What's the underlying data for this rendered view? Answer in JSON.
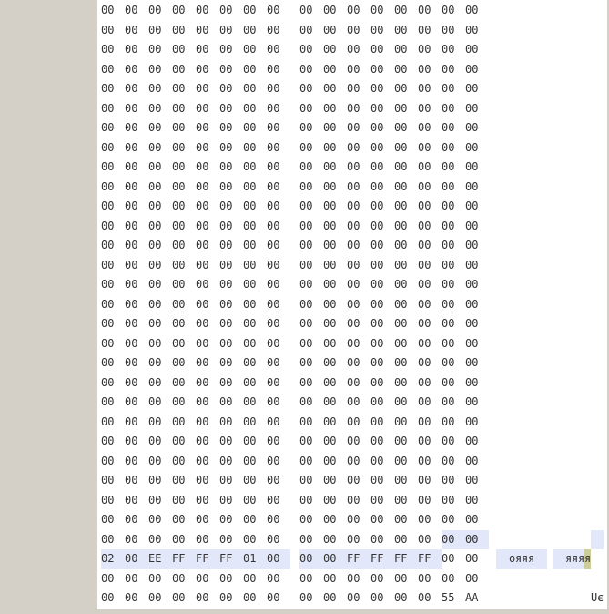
{
  "hex_rows": [
    {
      "bytes": [
        "00",
        "00",
        "00",
        "00",
        "00",
        "00",
        "00",
        "00",
        "00",
        "00",
        "00",
        "00",
        "00",
        "00",
        "00",
        "00"
      ],
      "highlights": []
    },
    {
      "bytes": [
        "00",
        "00",
        "00",
        "00",
        "00",
        "00",
        "00",
        "00",
        "00",
        "00",
        "00",
        "00",
        "00",
        "00",
        "00",
        "00"
      ],
      "highlights": []
    },
    {
      "bytes": [
        "00",
        "00",
        "00",
        "00",
        "00",
        "00",
        "00",
        "00",
        "00",
        "00",
        "00",
        "00",
        "00",
        "00",
        "00",
        "00"
      ],
      "highlights": []
    },
    {
      "bytes": [
        "00",
        "00",
        "00",
        "00",
        "00",
        "00",
        "00",
        "00",
        "00",
        "00",
        "00",
        "00",
        "00",
        "00",
        "00",
        "00"
      ],
      "highlights": []
    },
    {
      "bytes": [
        "00",
        "00",
        "00",
        "00",
        "00",
        "00",
        "00",
        "00",
        "00",
        "00",
        "00",
        "00",
        "00",
        "00",
        "00",
        "00"
      ],
      "highlights": []
    },
    {
      "bytes": [
        "00",
        "00",
        "00",
        "00",
        "00",
        "00",
        "00",
        "00",
        "00",
        "00",
        "00",
        "00",
        "00",
        "00",
        "00",
        "00"
      ],
      "highlights": []
    },
    {
      "bytes": [
        "00",
        "00",
        "00",
        "00",
        "00",
        "00",
        "00",
        "00",
        "00",
        "00",
        "00",
        "00",
        "00",
        "00",
        "00",
        "00"
      ],
      "highlights": []
    },
    {
      "bytes": [
        "00",
        "00",
        "00",
        "00",
        "00",
        "00",
        "00",
        "00",
        "00",
        "00",
        "00",
        "00",
        "00",
        "00",
        "00",
        "00"
      ],
      "highlights": []
    },
    {
      "bytes": [
        "00",
        "00",
        "00",
        "00",
        "00",
        "00",
        "00",
        "00",
        "00",
        "00",
        "00",
        "00",
        "00",
        "00",
        "00",
        "00"
      ],
      "highlights": []
    },
    {
      "bytes": [
        "00",
        "00",
        "00",
        "00",
        "00",
        "00",
        "00",
        "00",
        "00",
        "00",
        "00",
        "00",
        "00",
        "00",
        "00",
        "00"
      ],
      "highlights": []
    },
    {
      "bytes": [
        "00",
        "00",
        "00",
        "00",
        "00",
        "00",
        "00",
        "00",
        "00",
        "00",
        "00",
        "00",
        "00",
        "00",
        "00",
        "00"
      ],
      "highlights": []
    },
    {
      "bytes": [
        "00",
        "00",
        "00",
        "00",
        "00",
        "00",
        "00",
        "00",
        "00",
        "00",
        "00",
        "00",
        "00",
        "00",
        "00",
        "00"
      ],
      "highlights": []
    },
    {
      "bytes": [
        "00",
        "00",
        "00",
        "00",
        "00",
        "00",
        "00",
        "00",
        "00",
        "00",
        "00",
        "00",
        "00",
        "00",
        "00",
        "00"
      ],
      "highlights": []
    },
    {
      "bytes": [
        "00",
        "00",
        "00",
        "00",
        "00",
        "00",
        "00",
        "00",
        "00",
        "00",
        "00",
        "00",
        "00",
        "00",
        "00",
        "00"
      ],
      "highlights": []
    },
    {
      "bytes": [
        "00",
        "00",
        "00",
        "00",
        "00",
        "00",
        "00",
        "00",
        "00",
        "00",
        "00",
        "00",
        "00",
        "00",
        "00",
        "00"
      ],
      "highlights": []
    },
    {
      "bytes": [
        "00",
        "00",
        "00",
        "00",
        "00",
        "00",
        "00",
        "00",
        "00",
        "00",
        "00",
        "00",
        "00",
        "00",
        "00",
        "00"
      ],
      "highlights": []
    },
    {
      "bytes": [
        "00",
        "00",
        "00",
        "00",
        "00",
        "00",
        "00",
        "00",
        "00",
        "00",
        "00",
        "00",
        "00",
        "00",
        "00",
        "00"
      ],
      "highlights": []
    },
    {
      "bytes": [
        "00",
        "00",
        "00",
        "00",
        "00",
        "00",
        "00",
        "00",
        "00",
        "00",
        "00",
        "00",
        "00",
        "00",
        "00",
        "00"
      ],
      "highlights": []
    },
    {
      "bytes": [
        "00",
        "00",
        "00",
        "00",
        "00",
        "00",
        "00",
        "00",
        "00",
        "00",
        "00",
        "00",
        "00",
        "00",
        "00",
        "00"
      ],
      "highlights": []
    },
    {
      "bytes": [
        "00",
        "00",
        "00",
        "00",
        "00",
        "00",
        "00",
        "00",
        "00",
        "00",
        "00",
        "00",
        "00",
        "00",
        "00",
        "00"
      ],
      "highlights": []
    },
    {
      "bytes": [
        "00",
        "00",
        "00",
        "00",
        "00",
        "00",
        "00",
        "00",
        "00",
        "00",
        "00",
        "00",
        "00",
        "00",
        "00",
        "00"
      ],
      "highlights": []
    },
    {
      "bytes": [
        "00",
        "00",
        "00",
        "00",
        "00",
        "00",
        "00",
        "00",
        "00",
        "00",
        "00",
        "00",
        "00",
        "00",
        "00",
        "00"
      ],
      "highlights": []
    },
    {
      "bytes": [
        "00",
        "00",
        "00",
        "00",
        "00",
        "00",
        "00",
        "00",
        "00",
        "00",
        "00",
        "00",
        "00",
        "00",
        "00",
        "00"
      ],
      "highlights": []
    },
    {
      "bytes": [
        "00",
        "00",
        "00",
        "00",
        "00",
        "00",
        "00",
        "00",
        "00",
        "00",
        "00",
        "00",
        "00",
        "00",
        "00",
        "00"
      ],
      "highlights": []
    },
    {
      "bytes": [
        "00",
        "00",
        "00",
        "00",
        "00",
        "00",
        "00",
        "00",
        "00",
        "00",
        "00",
        "00",
        "00",
        "00",
        "00",
        "00"
      ],
      "highlights": []
    },
    {
      "bytes": [
        "00",
        "00",
        "00",
        "00",
        "00",
        "00",
        "00",
        "00",
        "00",
        "00",
        "00",
        "00",
        "00",
        "00",
        "00",
        "00"
      ],
      "highlights": []
    },
    {
      "bytes": [
        "00",
        "00",
        "00",
        "00",
        "00",
        "00",
        "00",
        "00",
        "00",
        "00",
        "00",
        "00",
        "00",
        "00",
        "00",
        "00"
      ],
      "highlights": []
    },
    {
      "bytes": [
        "00",
        "00",
        "00",
        "00",
        "00",
        "00",
        "00",
        "00",
        "00",
        "00",
        "00",
        "00",
        "00",
        "00",
        "00",
        "00"
      ],
      "highlights": [
        {
          "from": 14,
          "to": 15,
          "class": "hl-blue"
        }
      ]
    },
    {
      "bytes": [
        "02",
        "00",
        "EE",
        "FF",
        "FF",
        "FF",
        "01",
        "00",
        "00",
        "00",
        "FF",
        "FF",
        "FF",
        "FF",
        "00",
        "00"
      ],
      "highlights": [
        {
          "from": 0,
          "to": 13,
          "class": "hl-blue"
        }
      ]
    },
    {
      "bytes": [
        "00",
        "00",
        "00",
        "00",
        "00",
        "00",
        "00",
        "00",
        "00",
        "00",
        "00",
        "00",
        "00",
        "00",
        "00",
        "00"
      ],
      "highlights": []
    },
    {
      "bytes": [
        "00",
        "00",
        "00",
        "00",
        "00",
        "00",
        "00",
        "00",
        "00",
        "00",
        "00",
        "00",
        "00",
        "00",
        "55",
        "AA"
      ],
      "highlights": []
    }
  ],
  "ascii_rows": [
    {
      "chars": [
        " ",
        " ",
        " ",
        " ",
        " ",
        " ",
        " ",
        " ",
        " ",
        " ",
        " ",
        " ",
        " ",
        " ",
        " ",
        " "
      ],
      "highlights": []
    },
    {
      "chars": [
        " ",
        " ",
        " ",
        " ",
        " ",
        " ",
        " ",
        " ",
        " ",
        " ",
        " ",
        " ",
        " ",
        " ",
        " ",
        " "
      ],
      "highlights": []
    },
    {
      "chars": [
        " ",
        " ",
        " ",
        " ",
        " ",
        " ",
        " ",
        " ",
        " ",
        " ",
        " ",
        " ",
        " ",
        " ",
        " ",
        " "
      ],
      "highlights": []
    },
    {
      "chars": [
        " ",
        " ",
        " ",
        " ",
        " ",
        " ",
        " ",
        " ",
        " ",
        " ",
        " ",
        " ",
        " ",
        " ",
        " ",
        " "
      ],
      "highlights": []
    },
    {
      "chars": [
        " ",
        " ",
        " ",
        " ",
        " ",
        " ",
        " ",
        " ",
        " ",
        " ",
        " ",
        " ",
        " ",
        " ",
        " ",
        " "
      ],
      "highlights": []
    },
    {
      "chars": [
        " ",
        " ",
        " ",
        " ",
        " ",
        " ",
        " ",
        " ",
        " ",
        " ",
        " ",
        " ",
        " ",
        " ",
        " ",
        " "
      ],
      "highlights": []
    },
    {
      "chars": [
        " ",
        " ",
        " ",
        " ",
        " ",
        " ",
        " ",
        " ",
        " ",
        " ",
        " ",
        " ",
        " ",
        " ",
        " ",
        " "
      ],
      "highlights": []
    },
    {
      "chars": [
        " ",
        " ",
        " ",
        " ",
        " ",
        " ",
        " ",
        " ",
        " ",
        " ",
        " ",
        " ",
        " ",
        " ",
        " ",
        " "
      ],
      "highlights": []
    },
    {
      "chars": [
        " ",
        " ",
        " ",
        " ",
        " ",
        " ",
        " ",
        " ",
        " ",
        " ",
        " ",
        " ",
        " ",
        " ",
        " ",
        " "
      ],
      "highlights": []
    },
    {
      "chars": [
        " ",
        " ",
        " ",
        " ",
        " ",
        " ",
        " ",
        " ",
        " ",
        " ",
        " ",
        " ",
        " ",
        " ",
        " ",
        " "
      ],
      "highlights": []
    },
    {
      "chars": [
        " ",
        " ",
        " ",
        " ",
        " ",
        " ",
        " ",
        " ",
        " ",
        " ",
        " ",
        " ",
        " ",
        " ",
        " ",
        " "
      ],
      "highlights": []
    },
    {
      "chars": [
        " ",
        " ",
        " ",
        " ",
        " ",
        " ",
        " ",
        " ",
        " ",
        " ",
        " ",
        " ",
        " ",
        " ",
        " ",
        " "
      ],
      "highlights": []
    },
    {
      "chars": [
        " ",
        " ",
        " ",
        " ",
        " ",
        " ",
        " ",
        " ",
        " ",
        " ",
        " ",
        " ",
        " ",
        " ",
        " ",
        " "
      ],
      "highlights": []
    },
    {
      "chars": [
        " ",
        " ",
        " ",
        " ",
        " ",
        " ",
        " ",
        " ",
        " ",
        " ",
        " ",
        " ",
        " ",
        " ",
        " ",
        " "
      ],
      "highlights": []
    },
    {
      "chars": [
        " ",
        " ",
        " ",
        " ",
        " ",
        " ",
        " ",
        " ",
        " ",
        " ",
        " ",
        " ",
        " ",
        " ",
        " ",
        " "
      ],
      "highlights": []
    },
    {
      "chars": [
        " ",
        " ",
        " ",
        " ",
        " ",
        " ",
        " ",
        " ",
        " ",
        " ",
        " ",
        " ",
        " ",
        " ",
        " ",
        " "
      ],
      "highlights": []
    },
    {
      "chars": [
        " ",
        " ",
        " ",
        " ",
        " ",
        " ",
        " ",
        " ",
        " ",
        " ",
        " ",
        " ",
        " ",
        " ",
        " ",
        " "
      ],
      "highlights": []
    },
    {
      "chars": [
        " ",
        " ",
        " ",
        " ",
        " ",
        " ",
        " ",
        " ",
        " ",
        " ",
        " ",
        " ",
        " ",
        " ",
        " ",
        " "
      ],
      "highlights": []
    },
    {
      "chars": [
        " ",
        " ",
        " ",
        " ",
        " ",
        " ",
        " ",
        " ",
        " ",
        " ",
        " ",
        " ",
        " ",
        " ",
        " ",
        " "
      ],
      "highlights": []
    },
    {
      "chars": [
        " ",
        " ",
        " ",
        " ",
        " ",
        " ",
        " ",
        " ",
        " ",
        " ",
        " ",
        " ",
        " ",
        " ",
        " ",
        " "
      ],
      "highlights": []
    },
    {
      "chars": [
        " ",
        " ",
        " ",
        " ",
        " ",
        " ",
        " ",
        " ",
        " ",
        " ",
        " ",
        " ",
        " ",
        " ",
        " ",
        " "
      ],
      "highlights": []
    },
    {
      "chars": [
        " ",
        " ",
        " ",
        " ",
        " ",
        " ",
        " ",
        " ",
        " ",
        " ",
        " ",
        " ",
        " ",
        " ",
        " ",
        " "
      ],
      "highlights": []
    },
    {
      "chars": [
        " ",
        " ",
        " ",
        " ",
        " ",
        " ",
        " ",
        " ",
        " ",
        " ",
        " ",
        " ",
        " ",
        " ",
        " ",
        " "
      ],
      "highlights": []
    },
    {
      "chars": [
        " ",
        " ",
        " ",
        " ",
        " ",
        " ",
        " ",
        " ",
        " ",
        " ",
        " ",
        " ",
        " ",
        " ",
        " ",
        " "
      ],
      "highlights": []
    },
    {
      "chars": [
        " ",
        " ",
        " ",
        " ",
        " ",
        " ",
        " ",
        " ",
        " ",
        " ",
        " ",
        " ",
        " ",
        " ",
        " ",
        " "
      ],
      "highlights": []
    },
    {
      "chars": [
        " ",
        " ",
        " ",
        " ",
        " ",
        " ",
        " ",
        " ",
        " ",
        " ",
        " ",
        " ",
        " ",
        " ",
        " ",
        " "
      ],
      "highlights": []
    },
    {
      "chars": [
        " ",
        " ",
        " ",
        " ",
        " ",
        " ",
        " ",
        " ",
        " ",
        " ",
        " ",
        " ",
        " ",
        " ",
        " ",
        " "
      ],
      "highlights": []
    },
    {
      "chars": [
        " ",
        " ",
        " ",
        " ",
        " ",
        " ",
        " ",
        " ",
        " ",
        " ",
        " ",
        " ",
        " ",
        " ",
        " ",
        " "
      ],
      "highlights": [
        {
          "from": 14,
          "to": 15,
          "class": "hl-blue"
        }
      ]
    },
    {
      "chars": [
        " ",
        " ",
        "о",
        "я",
        "я",
        "я",
        " ",
        " ",
        " ",
        " ",
        "я",
        "я",
        "я",
        "я",
        " ",
        " "
      ],
      "highlights": [
        {
          "from": 0,
          "to": 12,
          "class": "hl-blue"
        },
        {
          "from": 13,
          "to": 13,
          "class": "hl-olive"
        }
      ]
    },
    {
      "chars": [
        " ",
        " ",
        " ",
        " ",
        " ",
        " ",
        " ",
        " ",
        " ",
        " ",
        " ",
        " ",
        " ",
        " ",
        " ",
        " "
      ],
      "highlights": []
    },
    {
      "chars": [
        " ",
        " ",
        " ",
        " ",
        " ",
        " ",
        " ",
        " ",
        " ",
        " ",
        " ",
        " ",
        " ",
        " ",
        "U",
        "є"
      ],
      "highlights": []
    }
  ]
}
